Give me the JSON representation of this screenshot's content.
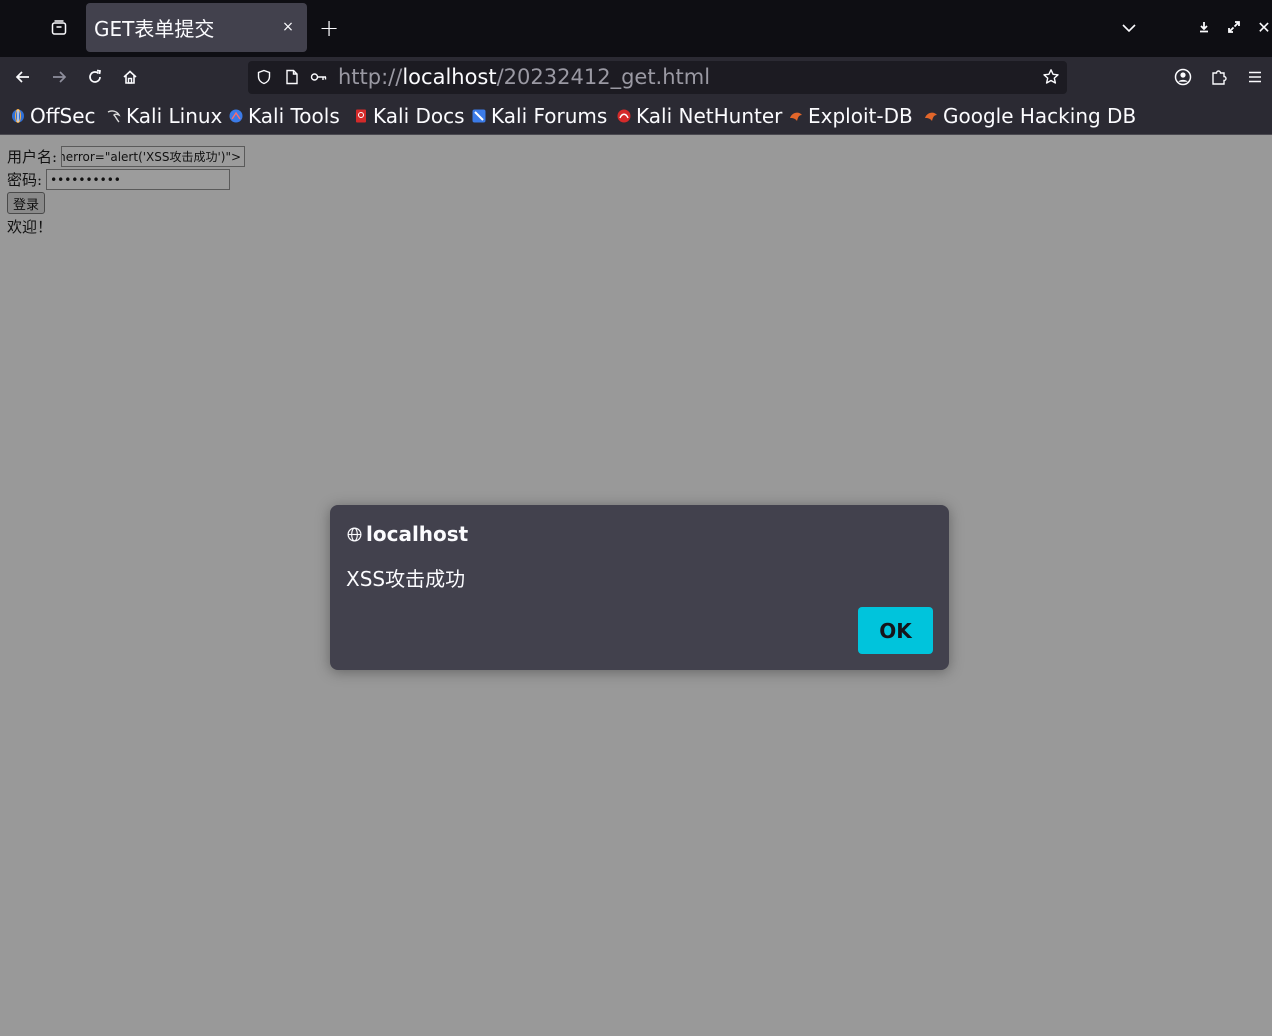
{
  "window": {
    "tab_title": "GET表单提交",
    "tab_close_icon": "×",
    "new_tab_icon": "+",
    "close_icon": "✕"
  },
  "navbar": {
    "url_scheme": "http://",
    "url_host": "localhost",
    "url_path": "/20232412_get.html"
  },
  "bookmarks": [
    {
      "label": "OffSec",
      "icon": "offsec-icon",
      "color": "#2f6fd6"
    },
    {
      "label": "Kali Linux",
      "icon": "kali-dragon-icon",
      "color": "#1a1a1a"
    },
    {
      "label": "Kali Tools",
      "icon": "kali-tools-icon",
      "color": "#3b7be8"
    },
    {
      "label": "Kali Docs",
      "icon": "kali-docs-icon",
      "color": "#d42a2a"
    },
    {
      "label": "Kali Forums",
      "icon": "kali-forums-icon",
      "color": "#3b7be8"
    },
    {
      "label": "Kali NetHunter",
      "icon": "nethunter-icon",
      "color": "#d42a2a"
    },
    {
      "label": "Exploit-DB",
      "icon": "exploit-db-icon",
      "color": "#e2662a"
    },
    {
      "label": "Google Hacking DB",
      "icon": "ghdb-icon",
      "color": "#e2662a"
    }
  ],
  "form": {
    "username_label": "用户名:",
    "username_value": "<img src=x onerror=\"alert('XSS攻击成功')\">",
    "password_label": "密码:",
    "password_value": "••••••••••",
    "login_button": "登录",
    "welcome_text": "欢迎！"
  },
  "dialog": {
    "title": "localhost",
    "message": "XSS攻击成功",
    "ok_label": "OK",
    "ok_color": "#00c4dc"
  }
}
